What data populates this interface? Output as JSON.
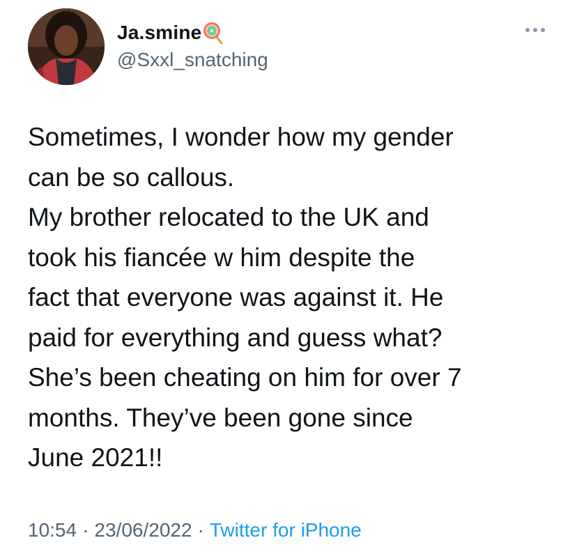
{
  "tweet": {
    "author": {
      "display_name": "Ja.smine",
      "name_emoji": "lollipop-icon",
      "handle": "@Sxxl_snatching"
    },
    "more_icon": "more-horizontal-icon",
    "body_lines": [
      "Sometimes, I wonder how my gender",
      "can be so callous.",
      "My brother relocated to the UK and",
      "took his fiancée w him despite the",
      "fact that everyone was against it. He",
      "paid for everything and guess what?",
      "She’s been cheating on him for over 7",
      "months. They’ve been gone since",
      "June 2021!!"
    ],
    "time": "10:54",
    "separator": "·",
    "date": "23/06/2022",
    "source": "Twitter for iPhone"
  },
  "colors": {
    "text_primary": "#0f1419",
    "text_secondary": "#536471",
    "link": "#1d9bf0"
  }
}
